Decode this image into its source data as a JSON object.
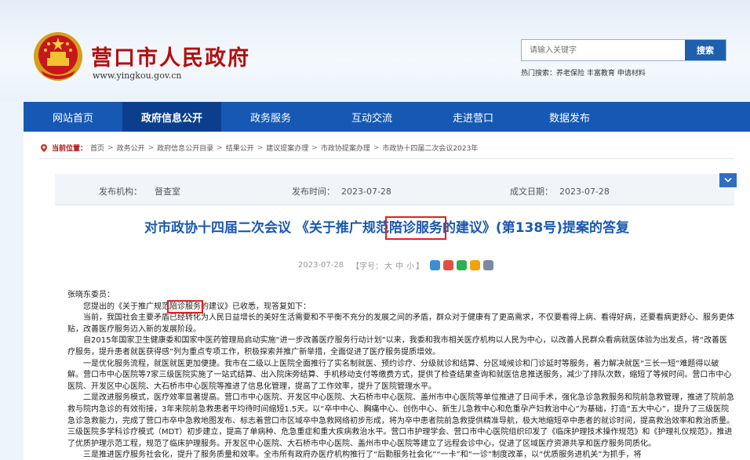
{
  "header": {
    "site_title": "营口市人民政府",
    "site_domain": "www.yingkou.gov.cn",
    "search": {
      "placeholder": "请输入关键字",
      "button_label": "搜索"
    },
    "hot_words": "热门搜索：养老保险 丰富教育 申请材料"
  },
  "nav": {
    "items": [
      {
        "label": "网站首页",
        "active": false
      },
      {
        "label": "政府信息公开",
        "active": true
      },
      {
        "label": "政务服务",
        "active": false
      },
      {
        "label": "互动交流",
        "active": false
      },
      {
        "label": "走进营口",
        "active": false
      },
      {
        "label": "数据发布",
        "active": false
      }
    ]
  },
  "breadcrumb": {
    "label": "当前位置：",
    "items": [
      "首页",
      "政务公开",
      "政府信息公开目录",
      "结果公开",
      "建议提案办理",
      "市政协提案办理",
      "市政协十四届二次会议2023年"
    ]
  },
  "info_bar": {
    "publisher_label": "发布机构：",
    "publisher": "督查室",
    "publish_date_label": "发布时间：",
    "publish_date": "2023-07-28",
    "created_label": "成文日期：",
    "created_date": "2023-07-28"
  },
  "document": {
    "title_before": "对市政协十四届二次会议 《关于推广规范",
    "title_highlight": "陪诊服务",
    "title_after": "的建议》(第138号)提案的答复",
    "meta_date": "2023-07-28",
    "font_label": "【字号：",
    "font_sizes": [
      "大",
      "中",
      "小"
    ],
    "font_end": "】",
    "salutation": "张晓东委员：",
    "p1_before": "您提出的《关于推广规范",
    "p1_highlight": "陪诊服务",
    "p1_after": "的建议》已收悉，现答复如下：",
    "paragraphs": [
      "当前，我国社会主要矛盾已经转化为人民日益增长的美好生活需要和不平衡不充分的发展之间的矛盾，群众对于健康有了更高需求，不仅要看得上病、看得好病，还要看病更舒心、服务更体贴，改善医疗服务迈入新的发展阶段。",
      "自2015年国家卫生健康委和国家中医药管理局启动实施“进一步改善医疗服务行动计划”以来，我委和我市相关医疗机构以人民为中心，以改善人民群众看病就医体验为出发点，将“改善医疗服务，提升患者就医获得感”列为重点专项工作，积极探索并推广新举措，全面促进了医疗服务提质增效。",
      "一是优化服务流程，就医就医更加便捷。我市在二级以上医院全面推行了实名制就医、预约诊疗、分级就诊和结算、分区域候诊和门诊延时等服务，着力解决就医“三长一短”难题得以破解。营口市中心医院等7家三级医院实施了一站式结算、出入院床旁结算、手机移动支付等缴费方式，提供了检查结果查询和就医信息推送服务，减少了排队次数，缩短了等候时间。营口市中心医院、开发区中心医院、大石桥市中心医院等推进了信息化管理，提高了工作效率，提升了医院管理水平。",
      "二是改进服务模式，医疗效率显著提高。营口市中心医院、开发区中心医院、大石桥市中心医院、盖州市中心医院等单位推进了日间手术，强化急诊急救服务和院前急救管理，推进了院前急救与院内急诊的有效衔接，3年来院前急救患者平均待时间缩短1.5天。以“卒中中心、胸痛中心、创伤中心、新生儿急救中心和危重孕产妇救治中心”为基础，打造“五大中心”，提升了三级医院急诊急救能力，完成了营口市卒中急救地图发布、标志着营口市区域卒中急救网络初步形成，将为卒中患者院前急救提供精准导航，极大地缩短卒中患者的就诊时间，提高救治效率和救治质量。三级医院多学科诊疗模式（MDT）初步建立，提高了单病种、危急重症和重大疾病救治水平。营口市护理学会、营口市中心医院组织印发了《临床护理技术操作规范》和《护理礼仪规范》，推进了优质护理示范工程，规范了临床护理服务。开发区中心医院、大石桥市中心医院、盖州市中心医院等建立了远程会诊中心，促进了区域医疗资源共享和医疗服务同质化。",
      "三是推进医疗服务社会化，提升了服务质量和效率。全市所有政府办医疗机构推行了“后勤服务社会化”“一卡”和“一诊”制度改革，以“优质服务进机关”为抓手，将"
    ]
  }
}
